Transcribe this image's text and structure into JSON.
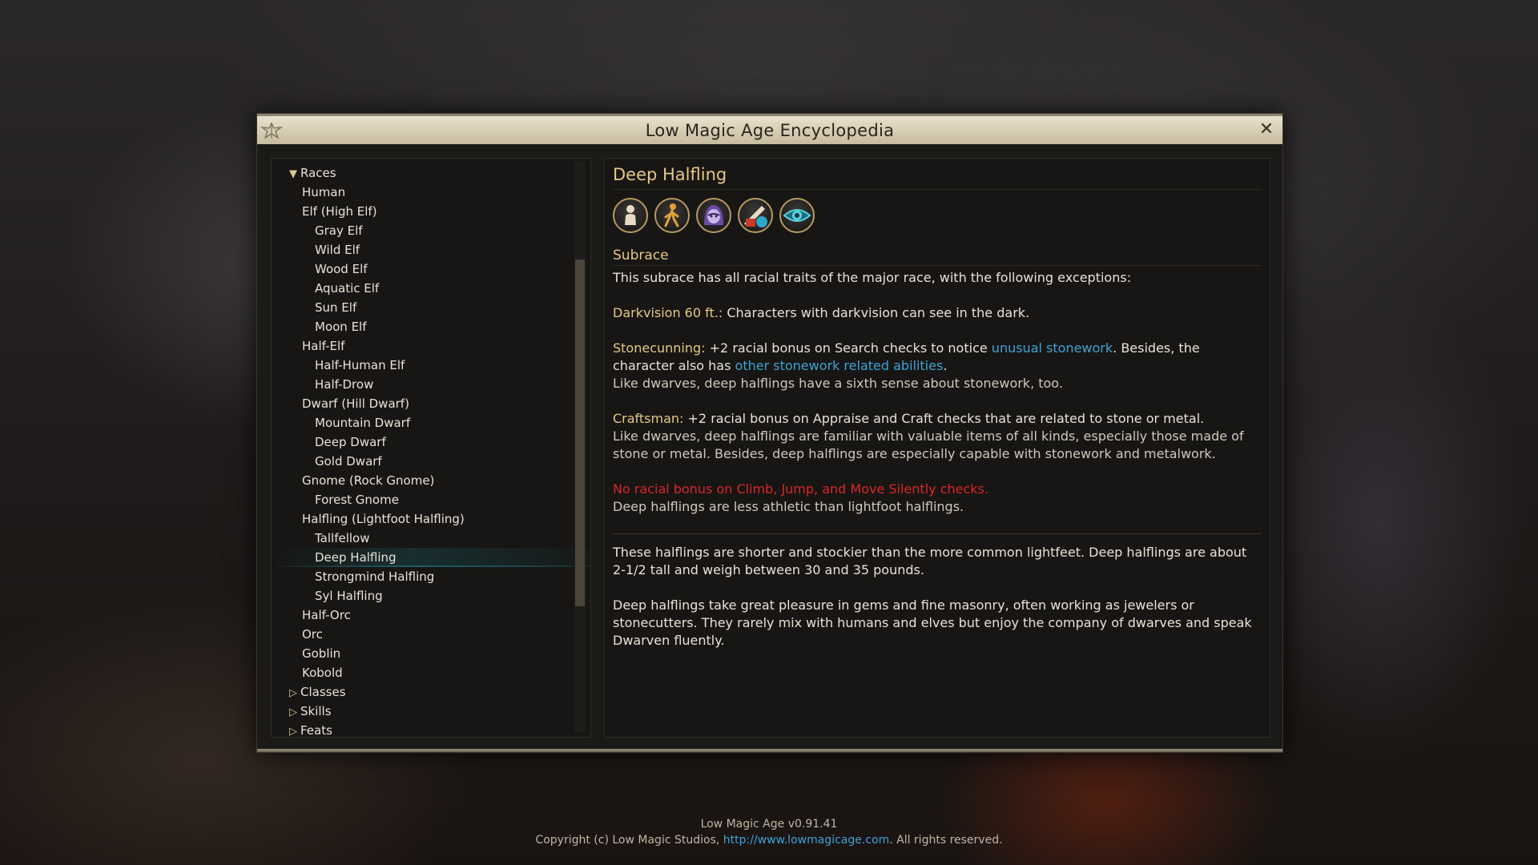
{
  "window": {
    "title": "Low Magic Age Encyclopedia"
  },
  "tree": {
    "items": [
      {
        "label": "Races",
        "level": 0,
        "arrow": "▼"
      },
      {
        "label": "Human",
        "level": 1
      },
      {
        "label": "Elf (High Elf)",
        "level": 1
      },
      {
        "label": "Gray Elf",
        "level": 2
      },
      {
        "label": "Wild Elf",
        "level": 2
      },
      {
        "label": "Wood Elf",
        "level": 2
      },
      {
        "label": "Aquatic Elf",
        "level": 2
      },
      {
        "label": "Sun Elf",
        "level": 2
      },
      {
        "label": "Moon Elf",
        "level": 2
      },
      {
        "label": "Half-Elf",
        "level": 1
      },
      {
        "label": "Half-Human Elf",
        "level": 2
      },
      {
        "label": "Half-Drow",
        "level": 2
      },
      {
        "label": "Dwarf (Hill Dwarf)",
        "level": 1
      },
      {
        "label": "Mountain Dwarf",
        "level": 2
      },
      {
        "label": "Deep Dwarf",
        "level": 2
      },
      {
        "label": "Gold Dwarf",
        "level": 2
      },
      {
        "label": "Gnome (Rock Gnome)",
        "level": 1
      },
      {
        "label": "Forest Gnome",
        "level": 2
      },
      {
        "label": "Halfling (Lightfoot Halfling)",
        "level": 1
      },
      {
        "label": "Tallfellow",
        "level": 2
      },
      {
        "label": "Deep Halfling",
        "level": 2,
        "selected": true
      },
      {
        "label": "Strongmind Halfling",
        "level": 2
      },
      {
        "label": "Syl Halfling",
        "level": 2
      },
      {
        "label": "Half-Orc",
        "level": 1
      },
      {
        "label": "Orc",
        "level": 1
      },
      {
        "label": "Goblin",
        "level": 1
      },
      {
        "label": "Kobold",
        "level": 1
      },
      {
        "label": "Classes",
        "level": 0,
        "arrow": "▷"
      },
      {
        "label": "Skills",
        "level": 0,
        "arrow": "▷"
      },
      {
        "label": "Feats",
        "level": 0,
        "arrow": "▷"
      }
    ]
  },
  "detail": {
    "title": "Deep Halfling",
    "icons": [
      "humanoid-figure-icon",
      "walking-figure-icon",
      "hooded-face-icon",
      "craft-tools-icon",
      "eye-icon"
    ],
    "subrace_heading": "Subrace",
    "intro": "This subrace has all racial traits of the major race, with the following exceptions:",
    "darkvision_label": "Darkvision 60 ft.:",
    "darkvision_text": " Characters with darkvision can see in the dark.",
    "stonecunning_label": "Stonecunning:",
    "stonecunning_text1": " +2 racial bonus on Search checks to notice ",
    "stonecunning_link1": "unusual stonework",
    "stonecunning_text2": ". Besides, the character also has ",
    "stonecunning_link2": "other stonework related abilities",
    "stonecunning_text3": ".",
    "stonecunning_note": "Like dwarves, deep halflings have a sixth sense about stonework, too.",
    "craftsman_label": "Craftsman:",
    "craftsman_text": " +2 racial bonus on Appraise and Craft checks that are related to stone or metal.",
    "craftsman_note": "Like dwarves, deep halflings are familiar with valuable items of all kinds, especially those made of stone or metal. Besides, deep halflings are especially capable with stonework and metalwork.",
    "penalty_text": "No racial bonus on Climb, Jump, and Move Silently checks.",
    "penalty_note": "Deep halflings are less athletic than lightfoot halflings.",
    "desc1": "These halflings are shorter and stockier than the more common lightfeet. Deep halflings are about 2-1/2 tall and weigh between 30 and 35 pounds.",
    "desc2": "Deep halflings take great pleasure in gems and fine masonry, often working as jewelers or stonecutters. They rarely mix with humans and elves but enjoy the company of dwarves and speak Dwarven fluently."
  },
  "footer": {
    "version": "Low Magic Age v0.91.41",
    "copyright_pre": "Copyright (c) Low Magic Studios, ",
    "url": "http://www.lowmagicage.com",
    "copyright_post": ". All rights reserved."
  },
  "colors": {
    "title_bar": "#d6ccb3",
    "heading_gold": "#e7c783",
    "link_blue": "#3ea3d8",
    "penalty_red": "#d82727",
    "selection_teal": "#23a0af"
  }
}
